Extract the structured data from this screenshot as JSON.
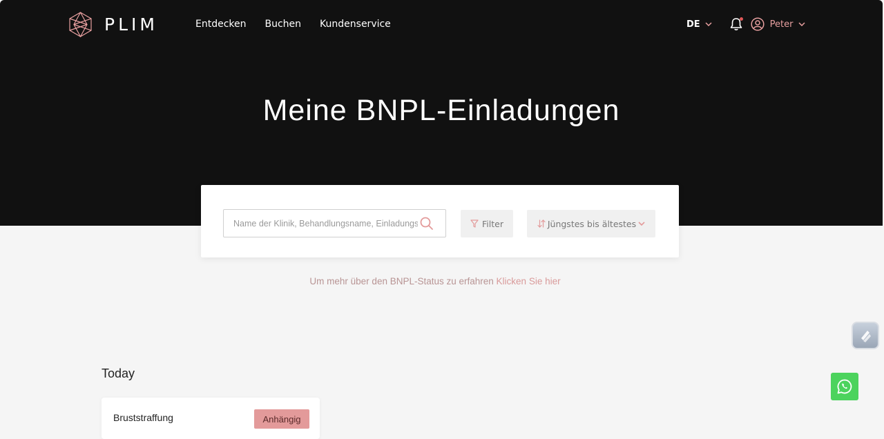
{
  "brand": {
    "name": "PLIM"
  },
  "nav": {
    "items": [
      {
        "label": "Entdecken"
      },
      {
        "label": "Buchen"
      },
      {
        "label": "Kundenservice"
      }
    ],
    "language": "DE",
    "user_name": "Peter"
  },
  "page": {
    "title": "Meine BNPL-Einladungen"
  },
  "search": {
    "placeholder": "Name der Klinik, Behandlungsname, Einladungs-ID",
    "value": ""
  },
  "toolbar": {
    "filter_label": "Filter",
    "sort_label": "Jüngstes bis ältestes"
  },
  "info": {
    "text": "Um mehr über den BNPL-Status zu erfahren ",
    "link": "Klicken Sie hier"
  },
  "groups": [
    {
      "label": "Today",
      "items": [
        {
          "title": "Bruststraffung",
          "status": "Anhängig"
        }
      ]
    }
  ],
  "colors": {
    "hero_bg": "#111111",
    "accent": "#e39a9a",
    "whatsapp": "#4cd35d"
  }
}
